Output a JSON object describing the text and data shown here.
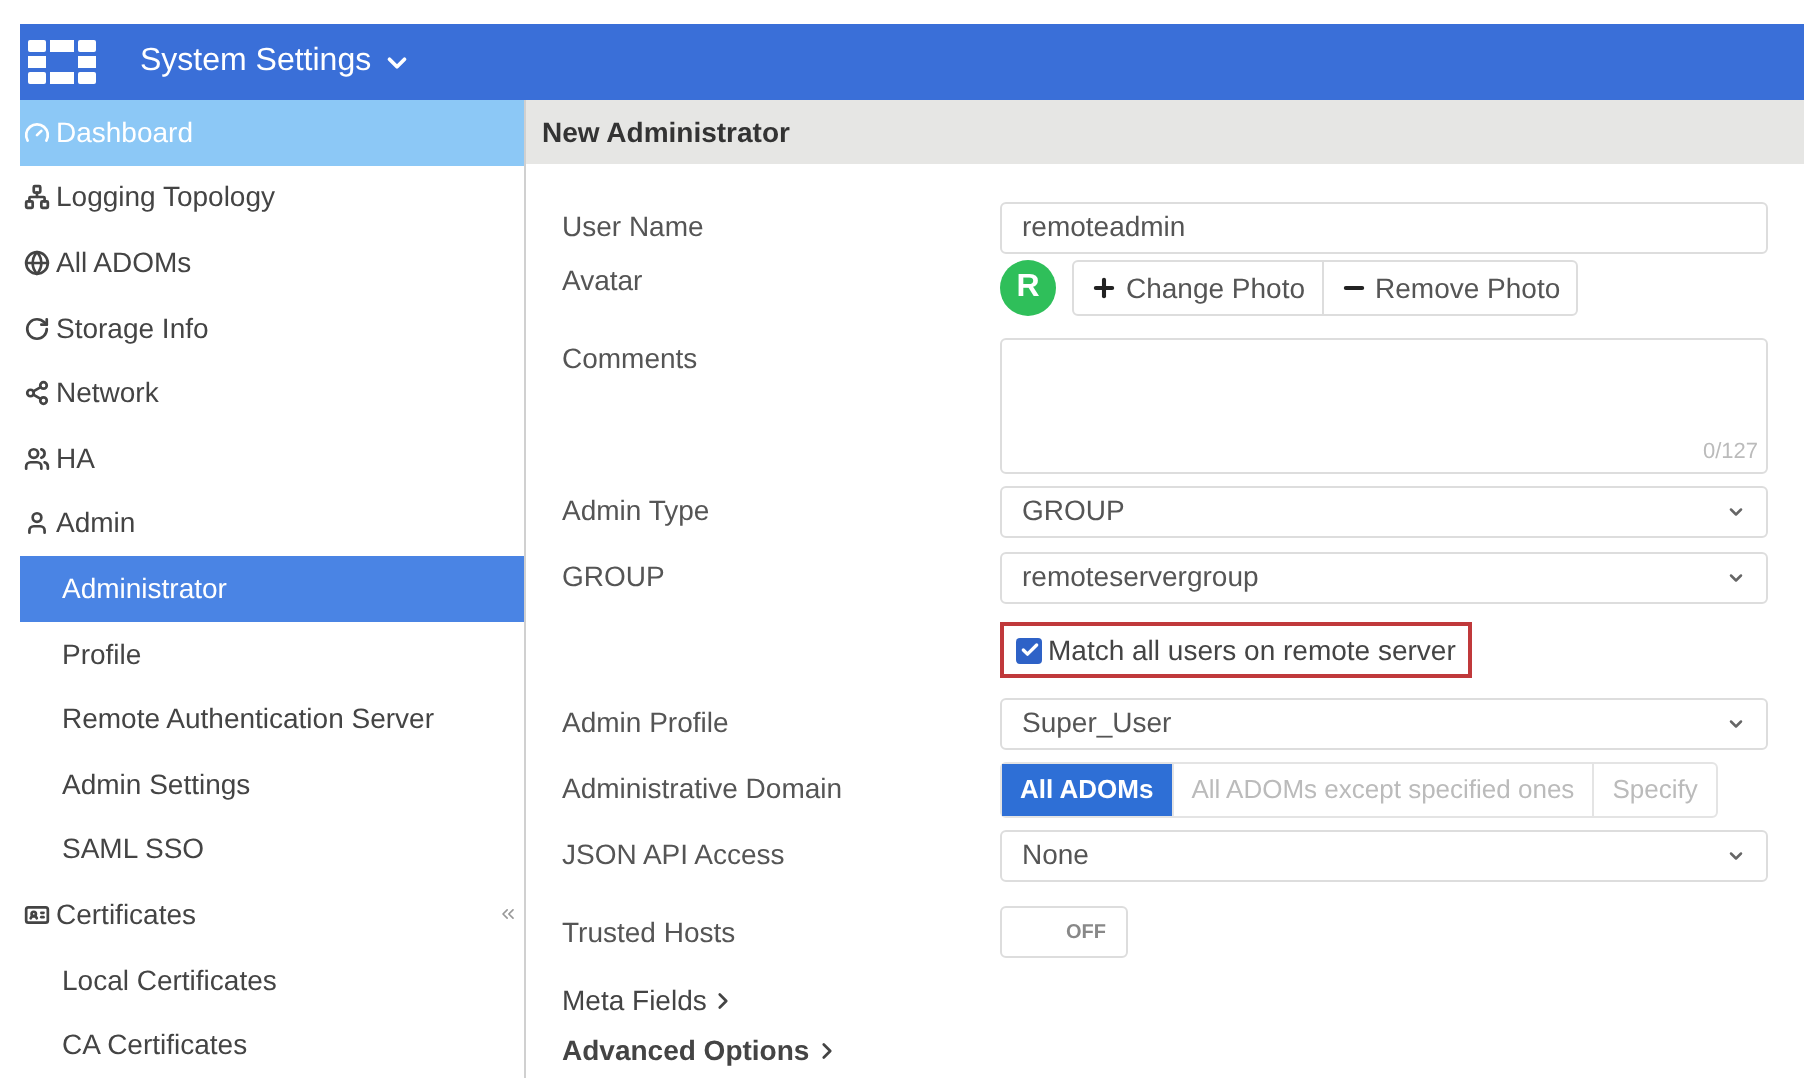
{
  "header": {
    "title": "System Settings"
  },
  "sidebar": {
    "items": [
      {
        "label": "Dashboard",
        "kind": "section",
        "selected": false,
        "hovered": true
      },
      {
        "label": "Logging Topology",
        "kind": "section",
        "selected": false,
        "hovered": false
      },
      {
        "label": "All ADOMs",
        "kind": "section",
        "selected": false,
        "hovered": false
      },
      {
        "label": "Storage Info",
        "kind": "section",
        "selected": false,
        "hovered": false
      },
      {
        "label": "Network",
        "kind": "section",
        "selected": false,
        "hovered": false
      },
      {
        "label": "HA",
        "kind": "section",
        "selected": false,
        "hovered": false
      },
      {
        "label": "Admin",
        "kind": "section",
        "selected": false,
        "hovered": false
      },
      {
        "label": "Administrator",
        "kind": "sub",
        "selected": true,
        "hovered": false
      },
      {
        "label": "Profile",
        "kind": "sub",
        "selected": false,
        "hovered": false
      },
      {
        "label": "Remote Authentication Server",
        "kind": "sub",
        "selected": false,
        "hovered": false
      },
      {
        "label": "Admin Settings",
        "kind": "sub",
        "selected": false,
        "hovered": false
      },
      {
        "label": "SAML SSO",
        "kind": "sub",
        "selected": false,
        "hovered": false
      },
      {
        "label": "Certificates",
        "kind": "section",
        "selected": false,
        "hovered": false
      },
      {
        "label": "Local Certificates",
        "kind": "sub",
        "selected": false,
        "hovered": false
      },
      {
        "label": "CA Certificates",
        "kind": "sub",
        "selected": false,
        "hovered": false
      }
    ]
  },
  "panel": {
    "title": "New Administrator",
    "rows": [
      {
        "kind": "text",
        "label": "User Name",
        "value": "remoteadmin"
      },
      {
        "kind": "avatar",
        "label": "Avatar",
        "initial": "R",
        "buttons": [
          "Change Photo",
          "Remove Photo"
        ]
      },
      {
        "kind": "textarea",
        "label": "Comments",
        "counter": "0/127"
      },
      {
        "kind": "select",
        "label": "Admin Type",
        "value": "GROUP"
      },
      {
        "kind": "select",
        "label": "GROUP",
        "value": "remoteservergroup"
      },
      {
        "kind": "checkbox",
        "text": "Match all users on remote server",
        "checked": true,
        "highlighted": true
      },
      {
        "kind": "select",
        "label": "Admin Profile",
        "value": "Super_User"
      },
      {
        "kind": "segmented",
        "label": "Administrative Domain",
        "options": [
          {
            "label": "All ADOMs",
            "selected": true
          },
          {
            "label": "All ADOMs except specified ones",
            "selected": false
          },
          {
            "label": "Specify",
            "selected": false
          }
        ]
      },
      {
        "kind": "select",
        "label": "JSON API Access",
        "value": "None"
      },
      {
        "kind": "toggle",
        "label": "Trusted Hosts",
        "on": false,
        "text": "OFF"
      },
      {
        "kind": "link",
        "label": "Meta Fields",
        "bold": false
      },
      {
        "kind": "link",
        "label": "Advanced Options",
        "bold": true
      }
    ]
  }
}
